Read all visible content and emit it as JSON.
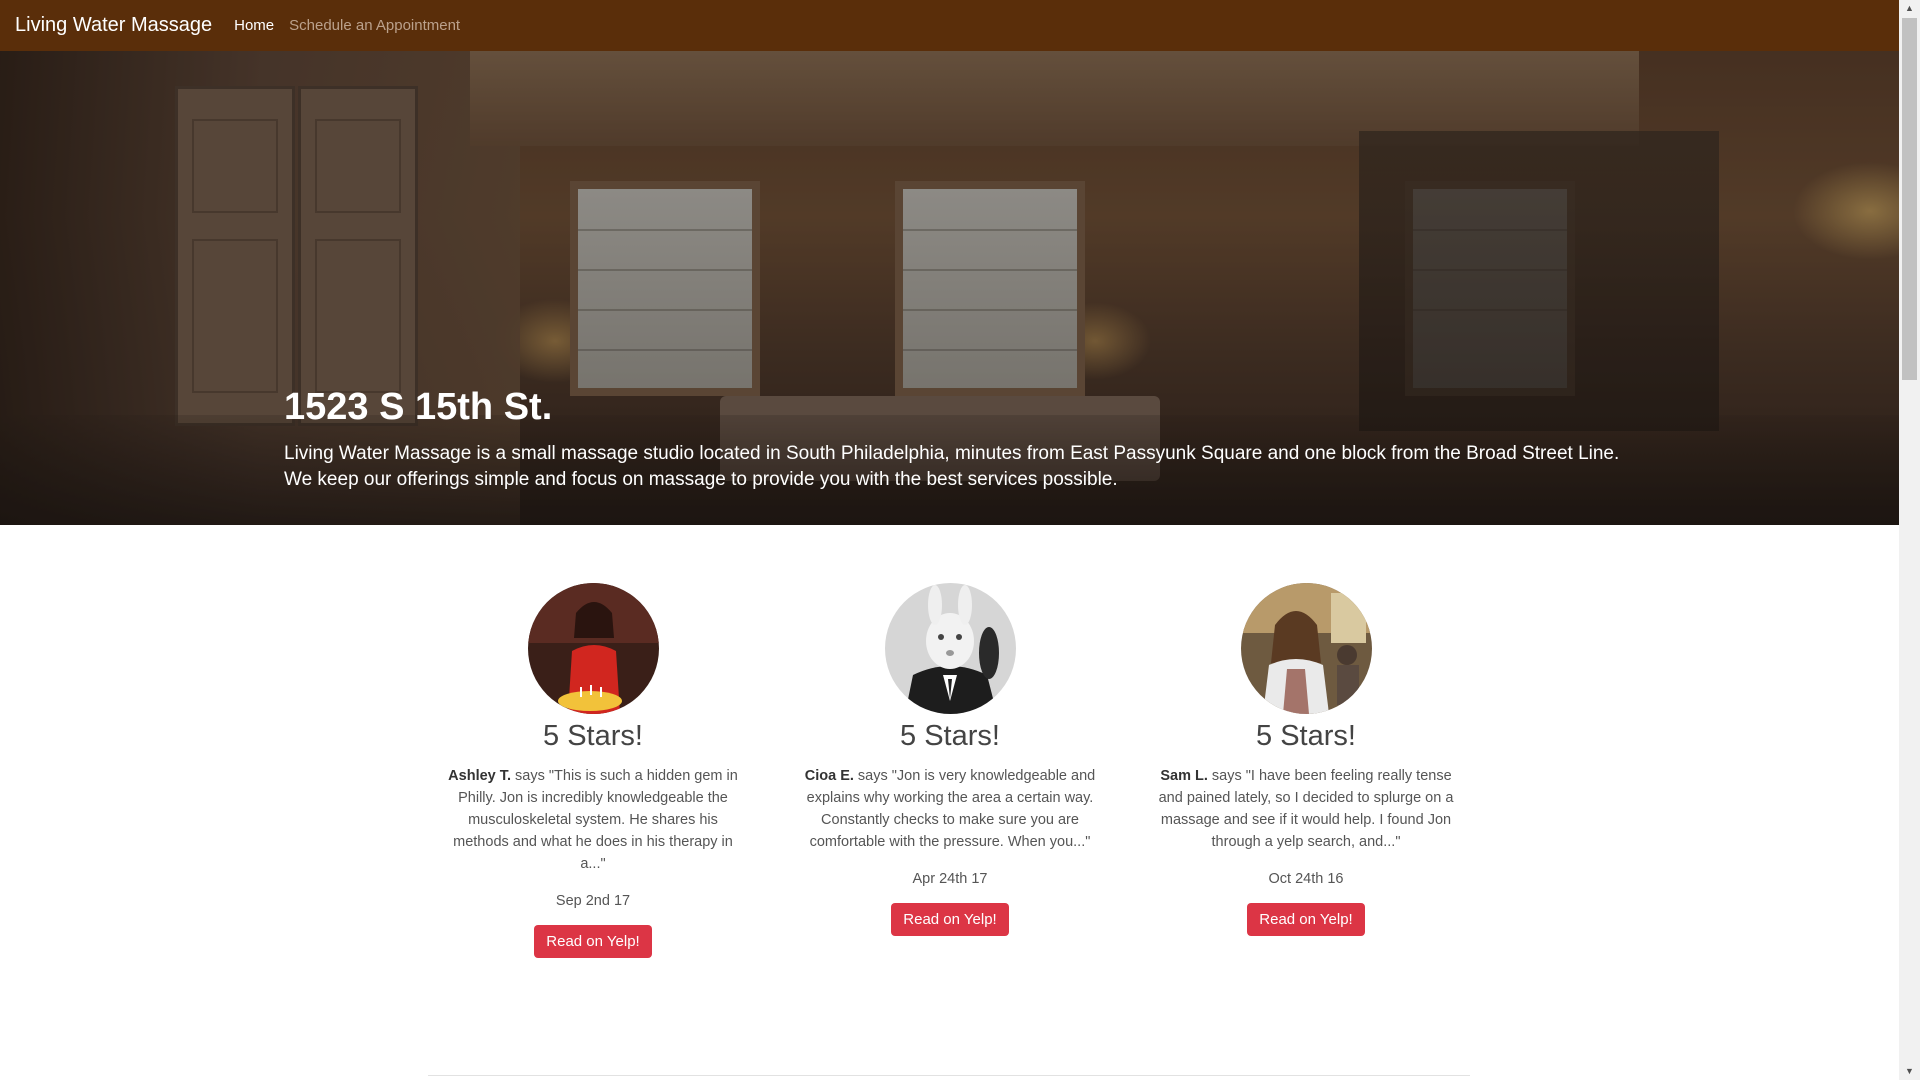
{
  "navbar": {
    "brand": "Living Water Massage",
    "links": [
      {
        "label": "Home",
        "active": true
      },
      {
        "label": "Schedule an Appointment",
        "active": false
      }
    ]
  },
  "hero": {
    "title": "1523 S 15th St.",
    "description": "Living Water Massage is a small massage studio located in South Philadelphia, minutes from East Passyunk Square and one block from the Broad Street Line. We keep our offerings simple and focus on massage to provide you with the best services possible."
  },
  "reviews": [
    {
      "rating": "5 Stars!",
      "author": "Ashley T.",
      "says": " says ",
      "quote": "\"This is such a hidden gem in Philly. Jon is incredibly knowledgeable the musculoskeletal system. He shares his methods and what he does in his therapy in a...\"",
      "date": "Sep 2nd 17",
      "button": "Read on Yelp!"
    },
    {
      "rating": "5 Stars!",
      "author": "Cioa E.",
      "says": " says ",
      "quote": "\"Jon is very knowledgeable and explains why working the area a certain way. Constantly checks to make sure you are comfortable with the pressure. When you...\"",
      "date": "Apr 24th 17",
      "button": "Read on Yelp!"
    },
    {
      "rating": "5 Stars!",
      "author": "Sam L.",
      "says": " says ",
      "quote": "\"I have been feeling really tense and pained lately, so I decided to splurge on a massage and see if it would help. I found Jon through a yelp search, and...\"",
      "date": "Oct 24th 16",
      "button": "Read on Yelp!"
    }
  ],
  "scrollbar": {
    "up_icon": "triangle-up",
    "down_icon": "triangle-down",
    "position": 0
  },
  "colors": {
    "navbar_bg": "#5a2e0a",
    "button_red": "#dc3545"
  }
}
